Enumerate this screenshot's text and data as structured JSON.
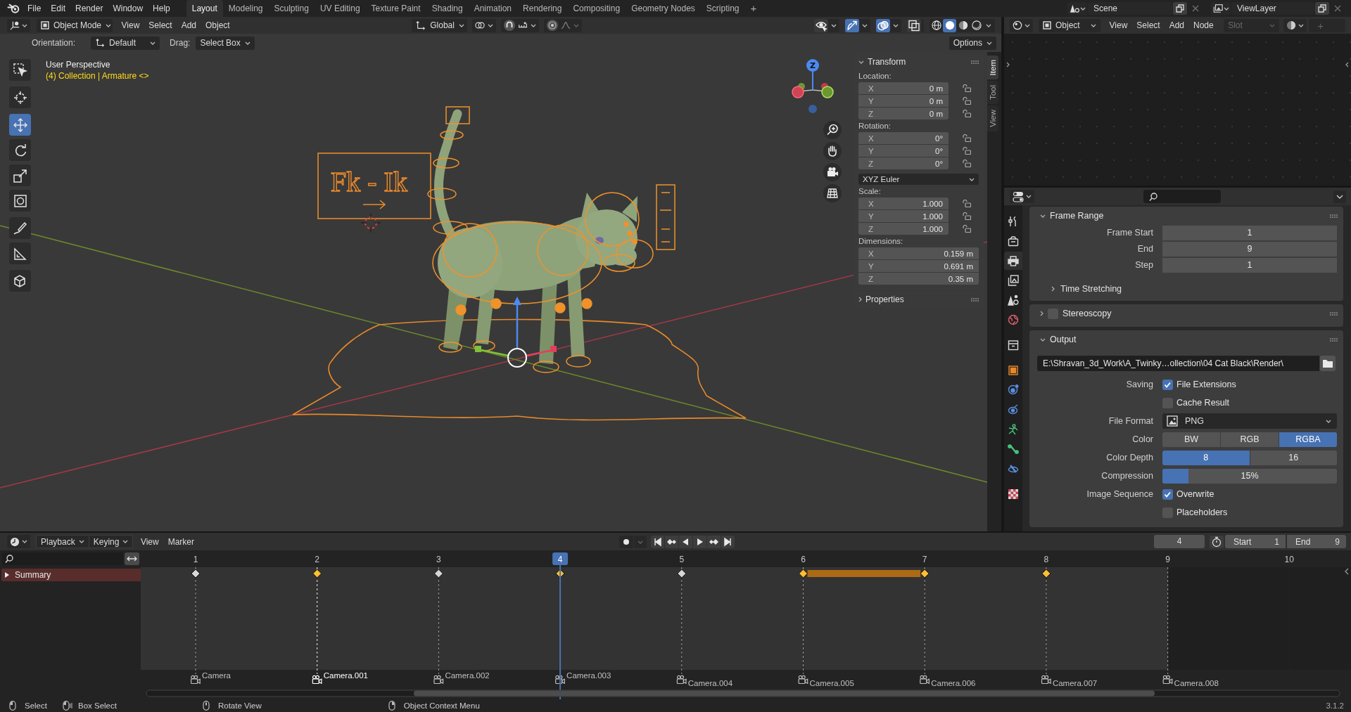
{
  "top_bar": {
    "menus": [
      "File",
      "Edit",
      "Render",
      "Window",
      "Help"
    ],
    "workspaces": [
      {
        "label": "Layout",
        "selected": true
      },
      {
        "label": "Modeling",
        "selected": false
      },
      {
        "label": "Sculpting",
        "selected": false
      },
      {
        "label": "UV Editing",
        "selected": false
      },
      {
        "label": "Texture Paint",
        "selected": false
      },
      {
        "label": "Shading",
        "selected": false
      },
      {
        "label": "Animation",
        "selected": false
      },
      {
        "label": "Rendering",
        "selected": false
      },
      {
        "label": "Compositing",
        "selected": false
      },
      {
        "label": "Geometry Nodes",
        "selected": false
      },
      {
        "label": "Scripting",
        "selected": false
      }
    ],
    "add_workspace": "+",
    "scene": "Scene",
    "view_layer": "ViewLayer"
  },
  "viewport": {
    "header": {
      "mode": "Object Mode",
      "menus": [
        "View",
        "Select",
        "Add",
        "Object"
      ],
      "transform_orientation": "Global",
      "toggles": [
        {
          "kind": "visibility",
          "on": false
        },
        {
          "kind": "gizmos",
          "on": true
        },
        {
          "kind": "overlays",
          "on": true
        },
        {
          "kind": "xray",
          "on": false
        }
      ],
      "shading": [
        {
          "kind": "wireframe",
          "selected": false
        },
        {
          "kind": "solid",
          "selected": true
        },
        {
          "kind": "material",
          "selected": false
        },
        {
          "kind": "rendered",
          "selected": false
        }
      ]
    },
    "tool_settings": {
      "orientation_label": "Orientation:",
      "orientation": "Default",
      "drag_label": "Drag:",
      "drag": "Select Box",
      "options": "Options"
    },
    "toolbar": [
      [
        {
          "kind": "select_box",
          "selected": false
        }
      ],
      [
        {
          "kind": "cursor",
          "selected": false
        }
      ],
      [
        {
          "kind": "move",
          "selected": true
        },
        {
          "kind": "rotate",
          "selected": false
        },
        {
          "kind": "scale",
          "selected": false
        },
        {
          "kind": "transform",
          "selected": false
        }
      ],
      [
        {
          "kind": "annotate",
          "selected": false
        },
        {
          "kind": "measure",
          "selected": false
        }
      ],
      [
        {
          "kind": "add_cube",
          "selected": false
        }
      ]
    ],
    "view_name": "User Perspective",
    "context": "(4) Collection | Armature <>",
    "rig_label": "Fk - Ik",
    "axis_label": "Z",
    "sidebar": {
      "tabs": [
        {
          "label": "Item",
          "selected": true
        },
        {
          "label": "Tool",
          "selected": false
        },
        {
          "label": "View",
          "selected": false
        }
      ],
      "panels": [
        {
          "title": "Transform",
          "expanded": true,
          "groups": [
            {
              "kind": "vector",
              "label": "Location:",
              "locks": true,
              "fields": [
                {
                  "axis": "X",
                  "value": "0 m"
                },
                {
                  "axis": "Y",
                  "value": "0 m"
                },
                {
                  "axis": "Z",
                  "value": "0 m"
                }
              ]
            },
            {
              "kind": "vector",
              "label": "Rotation:",
              "locks": true,
              "fields": [
                {
                  "axis": "X",
                  "value": "0°"
                },
                {
                  "axis": "Y",
                  "value": "0°"
                },
                {
                  "axis": "Z",
                  "value": "0°"
                }
              ]
            },
            {
              "kind": "dropdown",
              "value": "XYZ Euler"
            },
            {
              "kind": "vector",
              "label": "Scale:",
              "locks": true,
              "fields": [
                {
                  "axis": "X",
                  "value": "1.000"
                },
                {
                  "axis": "Y",
                  "value": "1.000"
                },
                {
                  "axis": "Z",
                  "value": "1.000"
                }
              ]
            },
            {
              "kind": "vector",
              "label": "Dimensions:",
              "locks": false,
              "fields": [
                {
                  "axis": "X",
                  "value": "0.159 m"
                },
                {
                  "axis": "Y",
                  "value": "0.691 m"
                },
                {
                  "axis": "Z",
                  "value": "0.35 m"
                }
              ]
            }
          ]
        },
        {
          "title": "Properties",
          "expanded": false
        }
      ]
    }
  },
  "node_editor": {
    "object": "Object",
    "menus": [
      "View",
      "Select",
      "Add",
      "Node"
    ],
    "slot": {
      "label": "Slot",
      "disabled": true
    },
    "add": {
      "label": "+",
      "disabled": true
    }
  },
  "properties": {
    "tabs": [
      {
        "kind": "tool",
        "selected": false
      },
      {
        "kind": "render",
        "selected": false
      },
      {
        "kind": "output",
        "selected": true
      },
      {
        "kind": "view_layer",
        "selected": false
      },
      {
        "kind": "scene",
        "selected": false
      },
      {
        "kind": "world",
        "selected": false
      },
      {
        "kind": "collection",
        "selected": false
      },
      {
        "kind": "object",
        "selected": false
      },
      {
        "kind": "physics",
        "selected": false
      },
      {
        "kind": "object_constraints",
        "selected": false
      },
      {
        "kind": "object_data",
        "selected": false
      },
      {
        "kind": "bone",
        "selected": false
      },
      {
        "kind": "bone_constraints",
        "selected": false
      },
      {
        "kind": "texture",
        "selected": false
      }
    ],
    "panels": [
      {
        "title": "Frame Range",
        "expanded": true,
        "rows": [
          {
            "kind": "number",
            "label": "Frame Start",
            "value": "1"
          },
          {
            "kind": "number",
            "label": "End",
            "value": "9"
          },
          {
            "kind": "number",
            "label": "Step",
            "value": "1"
          },
          {
            "kind": "subpanel",
            "title": "Time Stretching",
            "expanded": false
          }
        ]
      },
      {
        "title": "Stereoscopy",
        "expanded": false,
        "checked": false
      },
      {
        "title": "Output",
        "expanded": true,
        "rows": [
          {
            "kind": "path",
            "value": "E:\\Shravan_3d_Work\\A_Twinky…ollection\\04 Cat Black\\Render\\"
          },
          {
            "kind": "checkbox",
            "label": "Saving",
            "text": "File Extensions",
            "checked": true
          },
          {
            "kind": "checkbox",
            "text": "Cache Result",
            "checked": false
          },
          {
            "kind": "dropdown",
            "label": "File Format",
            "value": "PNG"
          },
          {
            "kind": "segmented",
            "label": "Color",
            "options": [
              {
                "label": "BW",
                "selected": false
              },
              {
                "label": "RGB",
                "selected": false
              },
              {
                "label": "RGBA",
                "selected": true
              }
            ]
          },
          {
            "kind": "segmented",
            "label": "Color Depth",
            "options": [
              {
                "label": "8",
                "selected": true
              },
              {
                "label": "16",
                "selected": false
              }
            ]
          },
          {
            "kind": "slider",
            "label": "Compression",
            "value": "15%",
            "level": 0.15
          },
          {
            "kind": "checkbox",
            "label": "Image Sequence",
            "text": "Overwrite",
            "checked": true
          },
          {
            "kind": "checkbox",
            "text": "Placeholders",
            "checked": false
          }
        ]
      }
    ]
  },
  "timeline": {
    "header": {
      "menus": [
        {
          "label": "Playback",
          "kind": "dropdown"
        },
        {
          "label": "Keying",
          "kind": "dropdown"
        },
        {
          "label": "View",
          "kind": "menu"
        },
        {
          "label": "Marker",
          "kind": "menu"
        }
      ],
      "current_frame": "4",
      "start_label": "Start",
      "start": "1",
      "end_label": "End",
      "end": "9"
    },
    "channels": [
      {
        "name": "Summary",
        "expanded": false
      }
    ],
    "frames": [
      {
        "label": "1",
        "selected": false,
        "in_range": true
      },
      {
        "label": "2",
        "selected": false,
        "in_range": true
      },
      {
        "label": "3",
        "selected": false,
        "in_range": true
      },
      {
        "label": "4",
        "selected": true,
        "in_range": true
      },
      {
        "label": "5",
        "selected": false,
        "in_range": true
      },
      {
        "label": "6",
        "selected": false,
        "in_range": true
      },
      {
        "label": "7",
        "selected": false,
        "in_range": true
      },
      {
        "label": "8",
        "selected": false,
        "in_range": true
      },
      {
        "label": "9",
        "selected": false,
        "in_range": true
      },
      {
        "label": "10",
        "selected": false,
        "in_range": false
      }
    ],
    "keyframes": [
      {
        "selected": false,
        "hold": false
      },
      {
        "selected": true,
        "hold": false
      },
      {
        "selected": false,
        "hold": false
      },
      {
        "selected": true,
        "hold": false
      },
      {
        "selected": false,
        "hold": false
      },
      {
        "selected": true,
        "hold": true
      },
      {
        "selected": true,
        "hold": false
      },
      {
        "selected": true,
        "hold": false
      }
    ],
    "markers": [
      {
        "name": "Camera",
        "selected": false
      },
      {
        "name": "Camera.001",
        "selected": true
      },
      {
        "name": "Camera.002",
        "selected": false
      },
      {
        "name": "Camera.003",
        "selected": false
      },
      {
        "name": "Camera.004",
        "selected": false
      },
      {
        "name": "Camera.005",
        "selected": false
      },
      {
        "name": "Camera.006",
        "selected": false
      },
      {
        "name": "Camera.007",
        "selected": false
      },
      {
        "name": "Camera.008",
        "selected": false
      }
    ]
  },
  "status_bar": {
    "hints": [
      {
        "kind": "left_click",
        "text": "Select"
      },
      {
        "kind": "left_drag",
        "text": "Box Select"
      },
      {
        "kind": "middle_drag",
        "text": "Rotate View"
      },
      {
        "kind": "right_click",
        "text": "Object Context Menu"
      }
    ],
    "version": "3.1.2"
  }
}
